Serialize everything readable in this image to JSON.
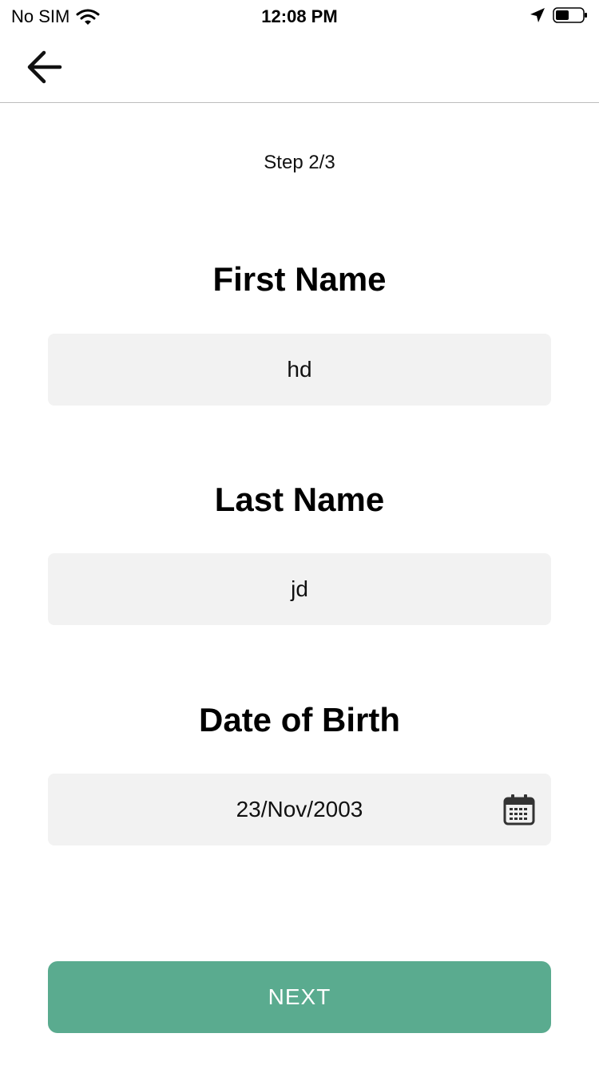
{
  "status_bar": {
    "carrier": "No SIM",
    "time": "12:08 PM",
    "icons": [
      "wifi-icon",
      "location-arrow-icon",
      "battery-icon"
    ]
  },
  "nav": {
    "back_icon": "arrow-left-icon"
  },
  "form": {
    "step": "Step 2/3",
    "first_name": {
      "label": "First Name",
      "value": "hd"
    },
    "last_name": {
      "label": "Last Name",
      "value": "jd"
    },
    "dob": {
      "label": "Date of Birth",
      "value": "23/Nov/2003",
      "icon": "calendar-icon"
    },
    "next_label": "NEXT"
  },
  "colors": {
    "button_bg": "#5aab8f",
    "field_bg": "#f2f2f2",
    "divider": "#bdbdbd"
  }
}
